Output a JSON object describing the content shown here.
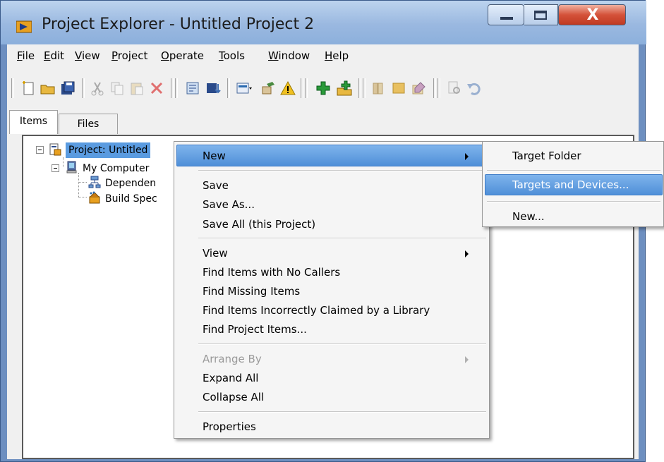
{
  "window": {
    "title": "Project Explorer - Untitled Project 2",
    "close_glyph": "X"
  },
  "menubar": [
    {
      "label": "File",
      "mnemonic": "F",
      "rest": "ile"
    },
    {
      "label": "Edit",
      "mnemonic": "E",
      "rest": "dit"
    },
    {
      "label": "View",
      "mnemonic": "V",
      "rest": "iew"
    },
    {
      "label": "Project",
      "mnemonic": "P",
      "rest": "roject"
    },
    {
      "label": "Operate",
      "mnemonic": "O",
      "rest": "perate"
    },
    {
      "label": "Tools",
      "mnemonic": "T",
      "rest": "ools"
    },
    {
      "label": "Window",
      "mnemonic": "W",
      "rest": "indow"
    },
    {
      "label": "Help",
      "mnemonic": "H",
      "rest": "elp"
    }
  ],
  "toolbar": {
    "icons": [
      "new-file-icon",
      "open-folder-icon",
      "save-all-icon",
      "cut-icon",
      "copy-icon",
      "paste-icon",
      "delete-icon",
      "project-settings-icon",
      "build-icon",
      "view-icon",
      "tools-icon",
      "warning-icon",
      "add-item-icon",
      "add-folder-icon",
      "library-icon",
      "class-icon",
      "edit-icon",
      "find-icon",
      "undo-icon"
    ]
  },
  "tabs": [
    {
      "label": "Items",
      "active": true
    },
    {
      "label": "Files",
      "active": false
    }
  ],
  "tree": [
    {
      "label": "Project: Untitled",
      "selected": true,
      "icon": "project-icon"
    },
    {
      "label": "My Computer",
      "icon": "computer-icon"
    },
    {
      "label": "Dependen",
      "icon": "dependencies-icon"
    },
    {
      "label": "Build Spec",
      "icon": "build-spec-icon"
    }
  ],
  "context_menu": {
    "groups": [
      [
        {
          "label": "New",
          "submenu": true,
          "highlighted": true
        }
      ],
      [
        {
          "label": "Save"
        },
        {
          "label": "Save As..."
        },
        {
          "label": "Save All (this Project)"
        }
      ],
      [
        {
          "label": "View",
          "submenu": true
        },
        {
          "label": "Find Items with No Callers"
        },
        {
          "label": "Find Missing Items"
        },
        {
          "label": "Find Items Incorrectly Claimed by a Library"
        },
        {
          "label": "Find Project Items..."
        }
      ],
      [
        {
          "label": "Arrange By",
          "submenu": true,
          "disabled": true
        },
        {
          "label": "Expand All"
        },
        {
          "label": "Collapse All"
        }
      ],
      [
        {
          "label": "Properties"
        }
      ]
    ]
  },
  "submenu": {
    "items": [
      {
        "label": "Target Folder"
      },
      {
        "label": "Targets and Devices...",
        "highlighted": true
      },
      {
        "label": "New..."
      }
    ]
  },
  "colors": {
    "highlight": "#5a9be0",
    "titlebar": "#9ab8e0",
    "close": "#c8442c"
  }
}
